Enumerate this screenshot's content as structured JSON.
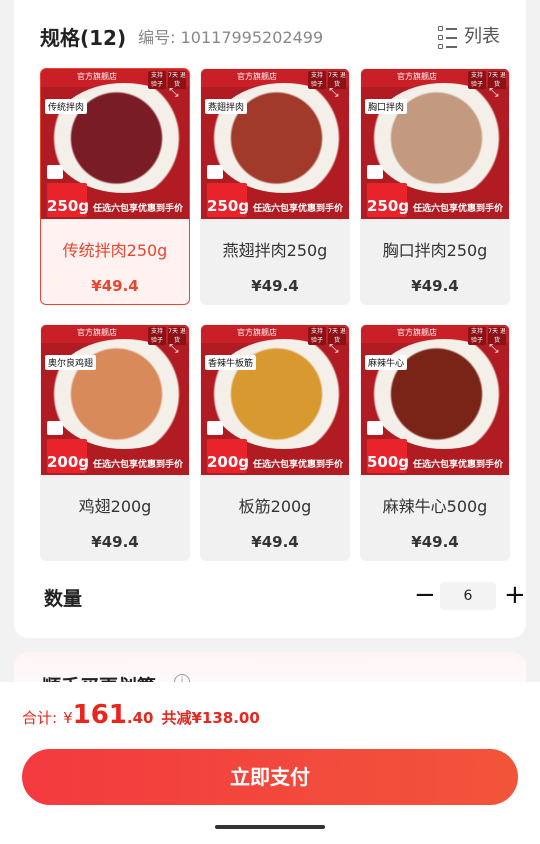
{
  "spec": {
    "title": "规格(12)",
    "code_label": "编号: 10117995202499",
    "list_label": "列表"
  },
  "products": [
    {
      "name": "传统拌肉250g",
      "price": "¥49.4",
      "tag": "传统拌肉",
      "weight": "250g",
      "selected": true,
      "food_color": "#7a1c25"
    },
    {
      "name": "燕翅拌肉250g",
      "price": "¥49.4",
      "tag": "燕翅拌肉",
      "weight": "250g",
      "selected": false,
      "food_color": "#a13a2a"
    },
    {
      "name": "胸口拌肉250g",
      "price": "¥49.4",
      "tag": "胸口拌肉",
      "weight": "250g",
      "selected": false,
      "food_color": "#c39a80"
    },
    {
      "name": "鸡翅200g",
      "price": "¥49.4",
      "tag": "奥尔良鸡翅",
      "weight": "200g",
      "selected": false,
      "food_color": "#d98a5a"
    },
    {
      "name": "板筋200g",
      "price": "¥49.4",
      "tag": "香辣牛板筋",
      "weight": "200g",
      "selected": false,
      "food_color": "#d89a30"
    },
    {
      "name": "麻辣牛心500g",
      "price": "¥49.4",
      "tag": "麻辣牛心",
      "weight": "500g",
      "selected": false,
      "food_color": "#7a2418"
    }
  ],
  "thumb_common": {
    "brand": "官方旗舰店",
    "promo": "任选六包享优惠到手价",
    "badge1": "支持 验子",
    "badge2": "7天 退货"
  },
  "quantity": {
    "label": "数量",
    "minus": "−",
    "value": "6",
    "plus": "+"
  },
  "addon": {
    "title": "顺手买更划算",
    "info_icon": "i"
  },
  "footer": {
    "total_label": "合计:",
    "currency": "¥",
    "amount_int": "161",
    "amount_dec": ".40",
    "discount": "共减¥138.00",
    "pay_button": "立即支付"
  },
  "colors": {
    "accent": "#e8462e",
    "pay_start": "#f33a3f",
    "pay_end": "#f2553a"
  }
}
